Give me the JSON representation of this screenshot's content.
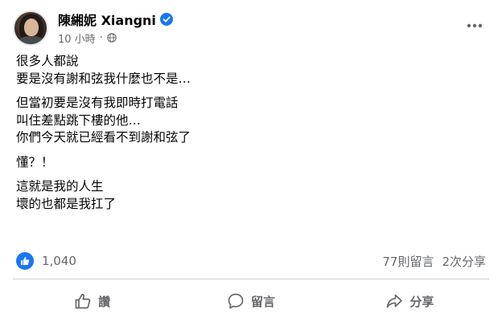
{
  "post": {
    "author": {
      "name": "陳緗妮 Xiangni",
      "verified": true
    },
    "time": "10 小時",
    "privacy_icon": "globe-icon",
    "content": [
      [
        "很多人都說",
        "要是沒有謝和弦我什麼也不是…"
      ],
      [
        "但當初要是沒有我即時打電話",
        "叫住差點跳下樓的他…",
        "你們今天就已經看不到謝和弦了"
      ],
      [
        "懂？！"
      ],
      [
        "這就是我的人生",
        "壞的也都是我扛了"
      ]
    ],
    "stats": {
      "reactions_count": "1,040",
      "comments": "77則留言",
      "shares": "2次分享"
    },
    "actions": {
      "like": "讚",
      "comment": "留言",
      "share": "分享"
    }
  },
  "colors": {
    "accent": "#1877f2",
    "secondary_text": "#65676b",
    "primary_text": "#050505",
    "divider": "#ced0d4"
  }
}
